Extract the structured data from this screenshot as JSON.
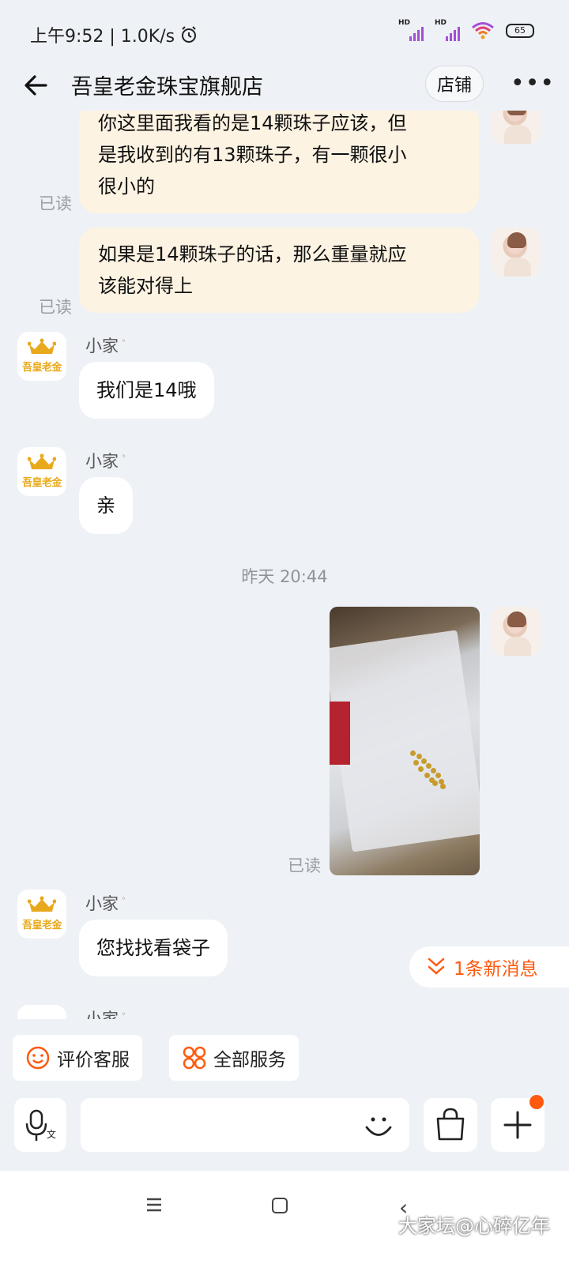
{
  "status_bar": {
    "time_speed": "上午9:52 | 1.0K/s",
    "sim1": "HD",
    "sim2": "HD",
    "battery": "65"
  },
  "header": {
    "title": "吾皇老金珠宝旗舰店",
    "shop_button": "店铺",
    "more_label": "•••"
  },
  "messages": [
    {
      "id": "m1",
      "side": "out",
      "text_lines": [
        "你这里面我看的是14颗珠子应该，但",
        "是我收到的有13颗珠子，有一颗很小",
        "很小的"
      ],
      "read": "已读"
    },
    {
      "id": "m2",
      "side": "out",
      "text_lines": [
        "如果是14颗珠子的话，那么重量就应",
        "该能对得上"
      ],
      "read": "已读"
    },
    {
      "id": "m3",
      "side": "in",
      "sender": "小家",
      "text": "我们是14哦"
    },
    {
      "id": "m4",
      "side": "in",
      "sender": "小家",
      "text": "亲"
    },
    {
      "id": "m5",
      "side": "out",
      "type": "image",
      "read": "已读"
    },
    {
      "id": "m6",
      "side": "in",
      "sender": "小家",
      "text": "您找找看袋子"
    },
    {
      "id": "m7",
      "side": "in",
      "sender": "小家"
    }
  ],
  "timestamp": "昨天  20:44",
  "shop_avatar_text": "吾皇老金",
  "new_messages": "1条新消息",
  "services": {
    "rate": "评价客服",
    "all": "全部服务"
  },
  "input": {
    "placeholder": ""
  },
  "watermark": "大家坛@心碎亿年",
  "colors": {
    "accent": "#ff5a0f",
    "out_bubble": "#fdf3e3",
    "background": "#eef1f5",
    "brand_gold": "#e8a91c"
  }
}
